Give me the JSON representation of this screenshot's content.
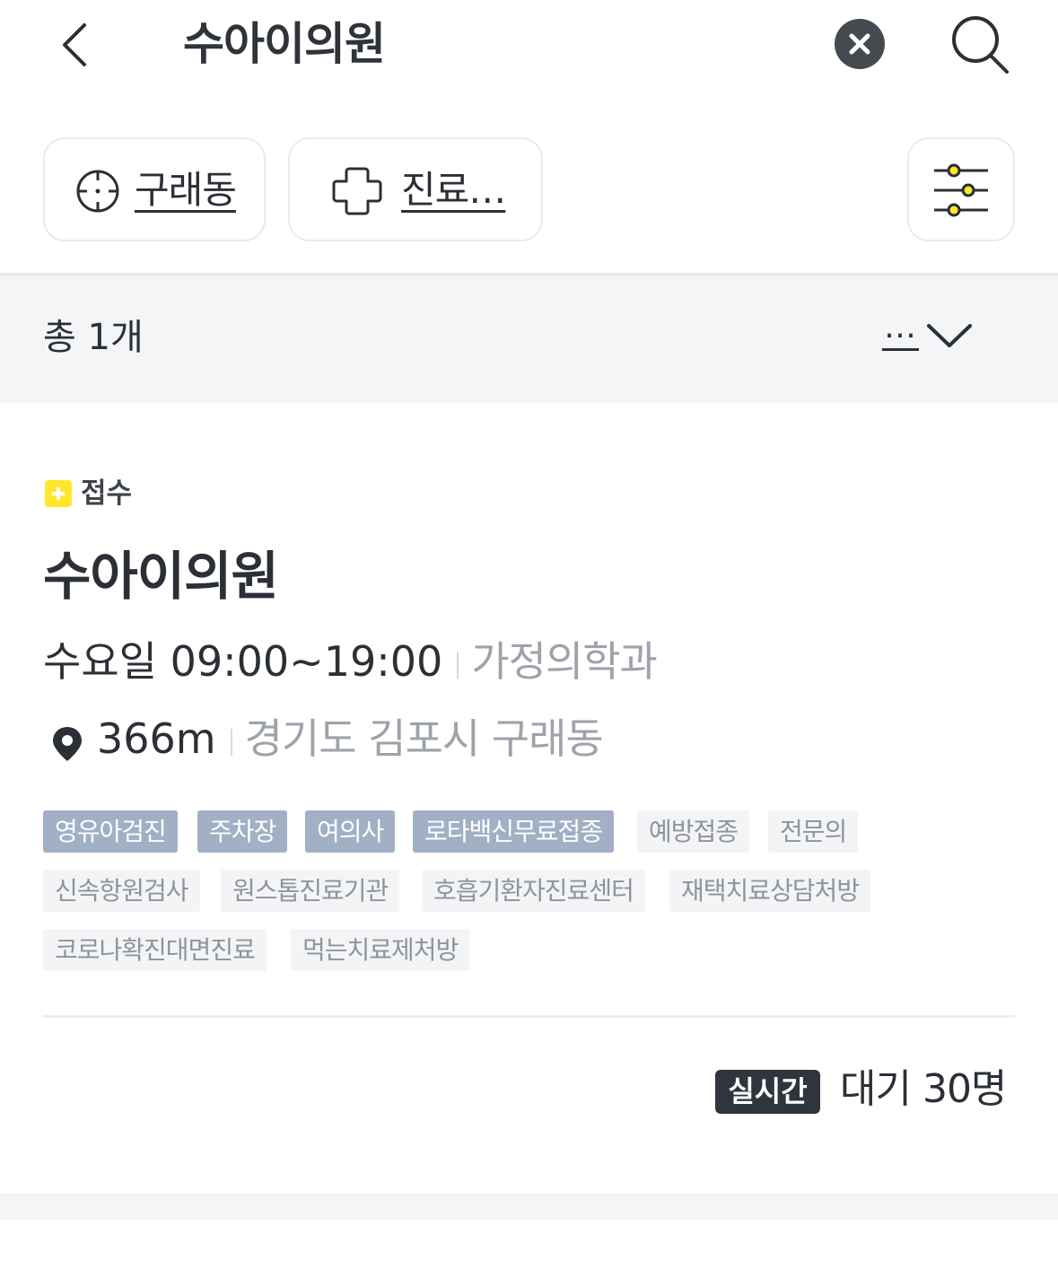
{
  "header": {
    "back_icon": "chevron-left-icon",
    "title": "수아이의원",
    "clear_icon": "close-circle-icon",
    "search_icon": "search-icon"
  },
  "filters": {
    "location": {
      "icon": "crosshair-icon",
      "label": "구래동"
    },
    "department": {
      "icon": "medical-cross-icon",
      "label": "진료…"
    },
    "settings_icon": "sliders-icon"
  },
  "summary": {
    "total": "총 1개",
    "sort_label": "…",
    "sort_icon": "chevron-down-icon"
  },
  "result": {
    "status": "접수",
    "status_color": "#ffe62b",
    "name": "수아이의원",
    "hours": "수요일 09:00~19:00",
    "department": "가정의학과",
    "distance": "366m",
    "address": "경기도 김포시 구래동",
    "tags": [
      {
        "label": "영유아검진",
        "highlight": true
      },
      {
        "label": "주차장",
        "highlight": true
      },
      {
        "label": "여의사",
        "highlight": true
      },
      {
        "label": "로타백신무료접종",
        "highlight": true
      },
      {
        "label": "예방접종",
        "highlight": false
      },
      {
        "label": "전문의",
        "highlight": false
      },
      {
        "label": "신속항원검사",
        "highlight": false
      },
      {
        "label": "원스톱진료기관",
        "highlight": false
      },
      {
        "label": "호흡기환자진료센터",
        "highlight": false
      },
      {
        "label": "재택치료상담처방",
        "highlight": false
      },
      {
        "label": "코로나확진대면진료",
        "highlight": false
      },
      {
        "label": "먹는치료제처방",
        "highlight": false
      }
    ],
    "realtime_badge": "실시간",
    "wait": "대기 30명"
  },
  "colors": {
    "tag_highlight": "#a1b0c4",
    "tag_normal": "#f3f4f6",
    "muted_text": "#9ea3aa"
  }
}
